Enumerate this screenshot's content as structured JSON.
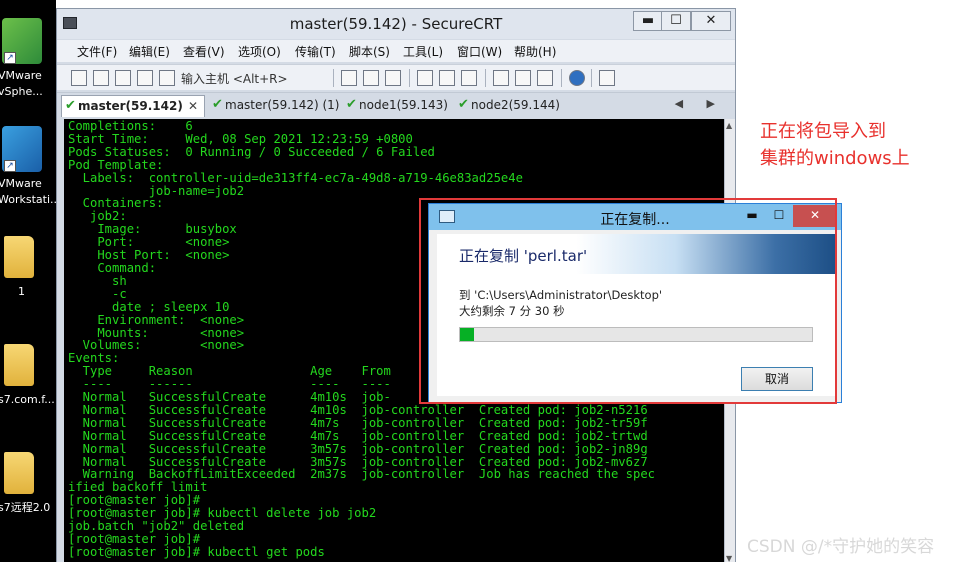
{
  "desktop": {
    "icons": [
      {
        "label_line1": "VMware",
        "label_line2": "vSphe..."
      },
      {
        "label_line1": "VMware",
        "label_line2": "Workstati..."
      },
      {
        "label_line1": "1",
        "label_line2": ""
      },
      {
        "label_line1": "s7.com.f...",
        "label_line2": ""
      },
      {
        "label_line1": "s7远程2.0",
        "label_line2": ""
      }
    ]
  },
  "securecrt": {
    "title": "master(59.142) - SecureCRT",
    "window_buttons": {
      "minimize": "▬",
      "maximize": "☐",
      "close": "✕"
    },
    "menu": [
      "文件(F)",
      "编辑(E)",
      "查看(V)",
      "选项(O)",
      "传输(T)",
      "脚本(S)",
      "工具(L)",
      "窗口(W)",
      "帮助(H)"
    ],
    "toolbar": {
      "host_input_placeholder": "输入主机 <Alt+R>"
    },
    "tabs": [
      {
        "label": "master(59.142)",
        "active": true
      },
      {
        "label": "master(59.142) (1)",
        "active": false
      },
      {
        "label": "node1(59.143)",
        "active": false
      },
      {
        "label": "node2(59.144)",
        "active": false
      }
    ],
    "tab_arrows": "◀ ▶",
    "terminal_lines": [
      "Completions:    6",
      "Start Time:     Wed, 08 Sep 2021 12:23:59 +0800",
      "Pods Statuses:  0 Running / 0 Succeeded / 6 Failed",
      "Pod Template:",
      "  Labels:  controller-uid=de313ff4-ec7a-49d8-a719-46e83ad25e4e",
      "           job-name=job2",
      "  Containers:",
      "   job2:",
      "    Image:      busybox",
      "    Port:       <none>",
      "    Host Port:  <none>",
      "    Command:",
      "      sh",
      "      -c",
      "      date ; sleepx 10",
      "    Environment:  <none>",
      "    Mounts:       <none>",
      "  Volumes:        <none>",
      "Events:",
      "  Type     Reason                Age    From",
      "  ----     ------                ----   ----",
      "  Normal   SuccessfulCreate      4m10s  job-",
      "  Normal   SuccessfulCreate      4m10s  job-controller  Created pod: job2-n5216",
      "  Normal   SuccessfulCreate      4m7s   job-controller  Created pod: job2-tr59f",
      "  Normal   SuccessfulCreate      4m7s   job-controller  Created pod: job2-trtwd",
      "  Normal   SuccessfulCreate      3m57s  job-controller  Created pod: job2-jn89g",
      "  Normal   SuccessfulCreate      3m57s  job-controller  Created pod: job2-mv6z7",
      "  Warning  BackoffLimitExceeded  2m37s  job-controller  Job has reached the spec",
      "ified backoff limit",
      "[root@master job]#",
      "[root@master job]# kubectl delete job job2",
      "job.batch \"job2\" deleted",
      "[root@master job]#",
      "[root@master job]# kubectl get pods"
    ]
  },
  "copy_dialog": {
    "title": "正在复制...",
    "header": "正在复制 'perl.tar'",
    "destination": "到 'C:\\Users\\Administrator\\Desktop'",
    "remaining": "大约剩余 7 分 30 秒",
    "progress_fraction": 0.04,
    "cancel_label": "取消",
    "buttons": {
      "minimize": "▬",
      "maximize": "☐",
      "close": "✕"
    }
  },
  "annotation": {
    "line1": "正在将包导入到",
    "line2": "集群的windows上",
    "color": "#e8312d"
  },
  "watermark": "CSDN @/*守护她的笑容"
}
